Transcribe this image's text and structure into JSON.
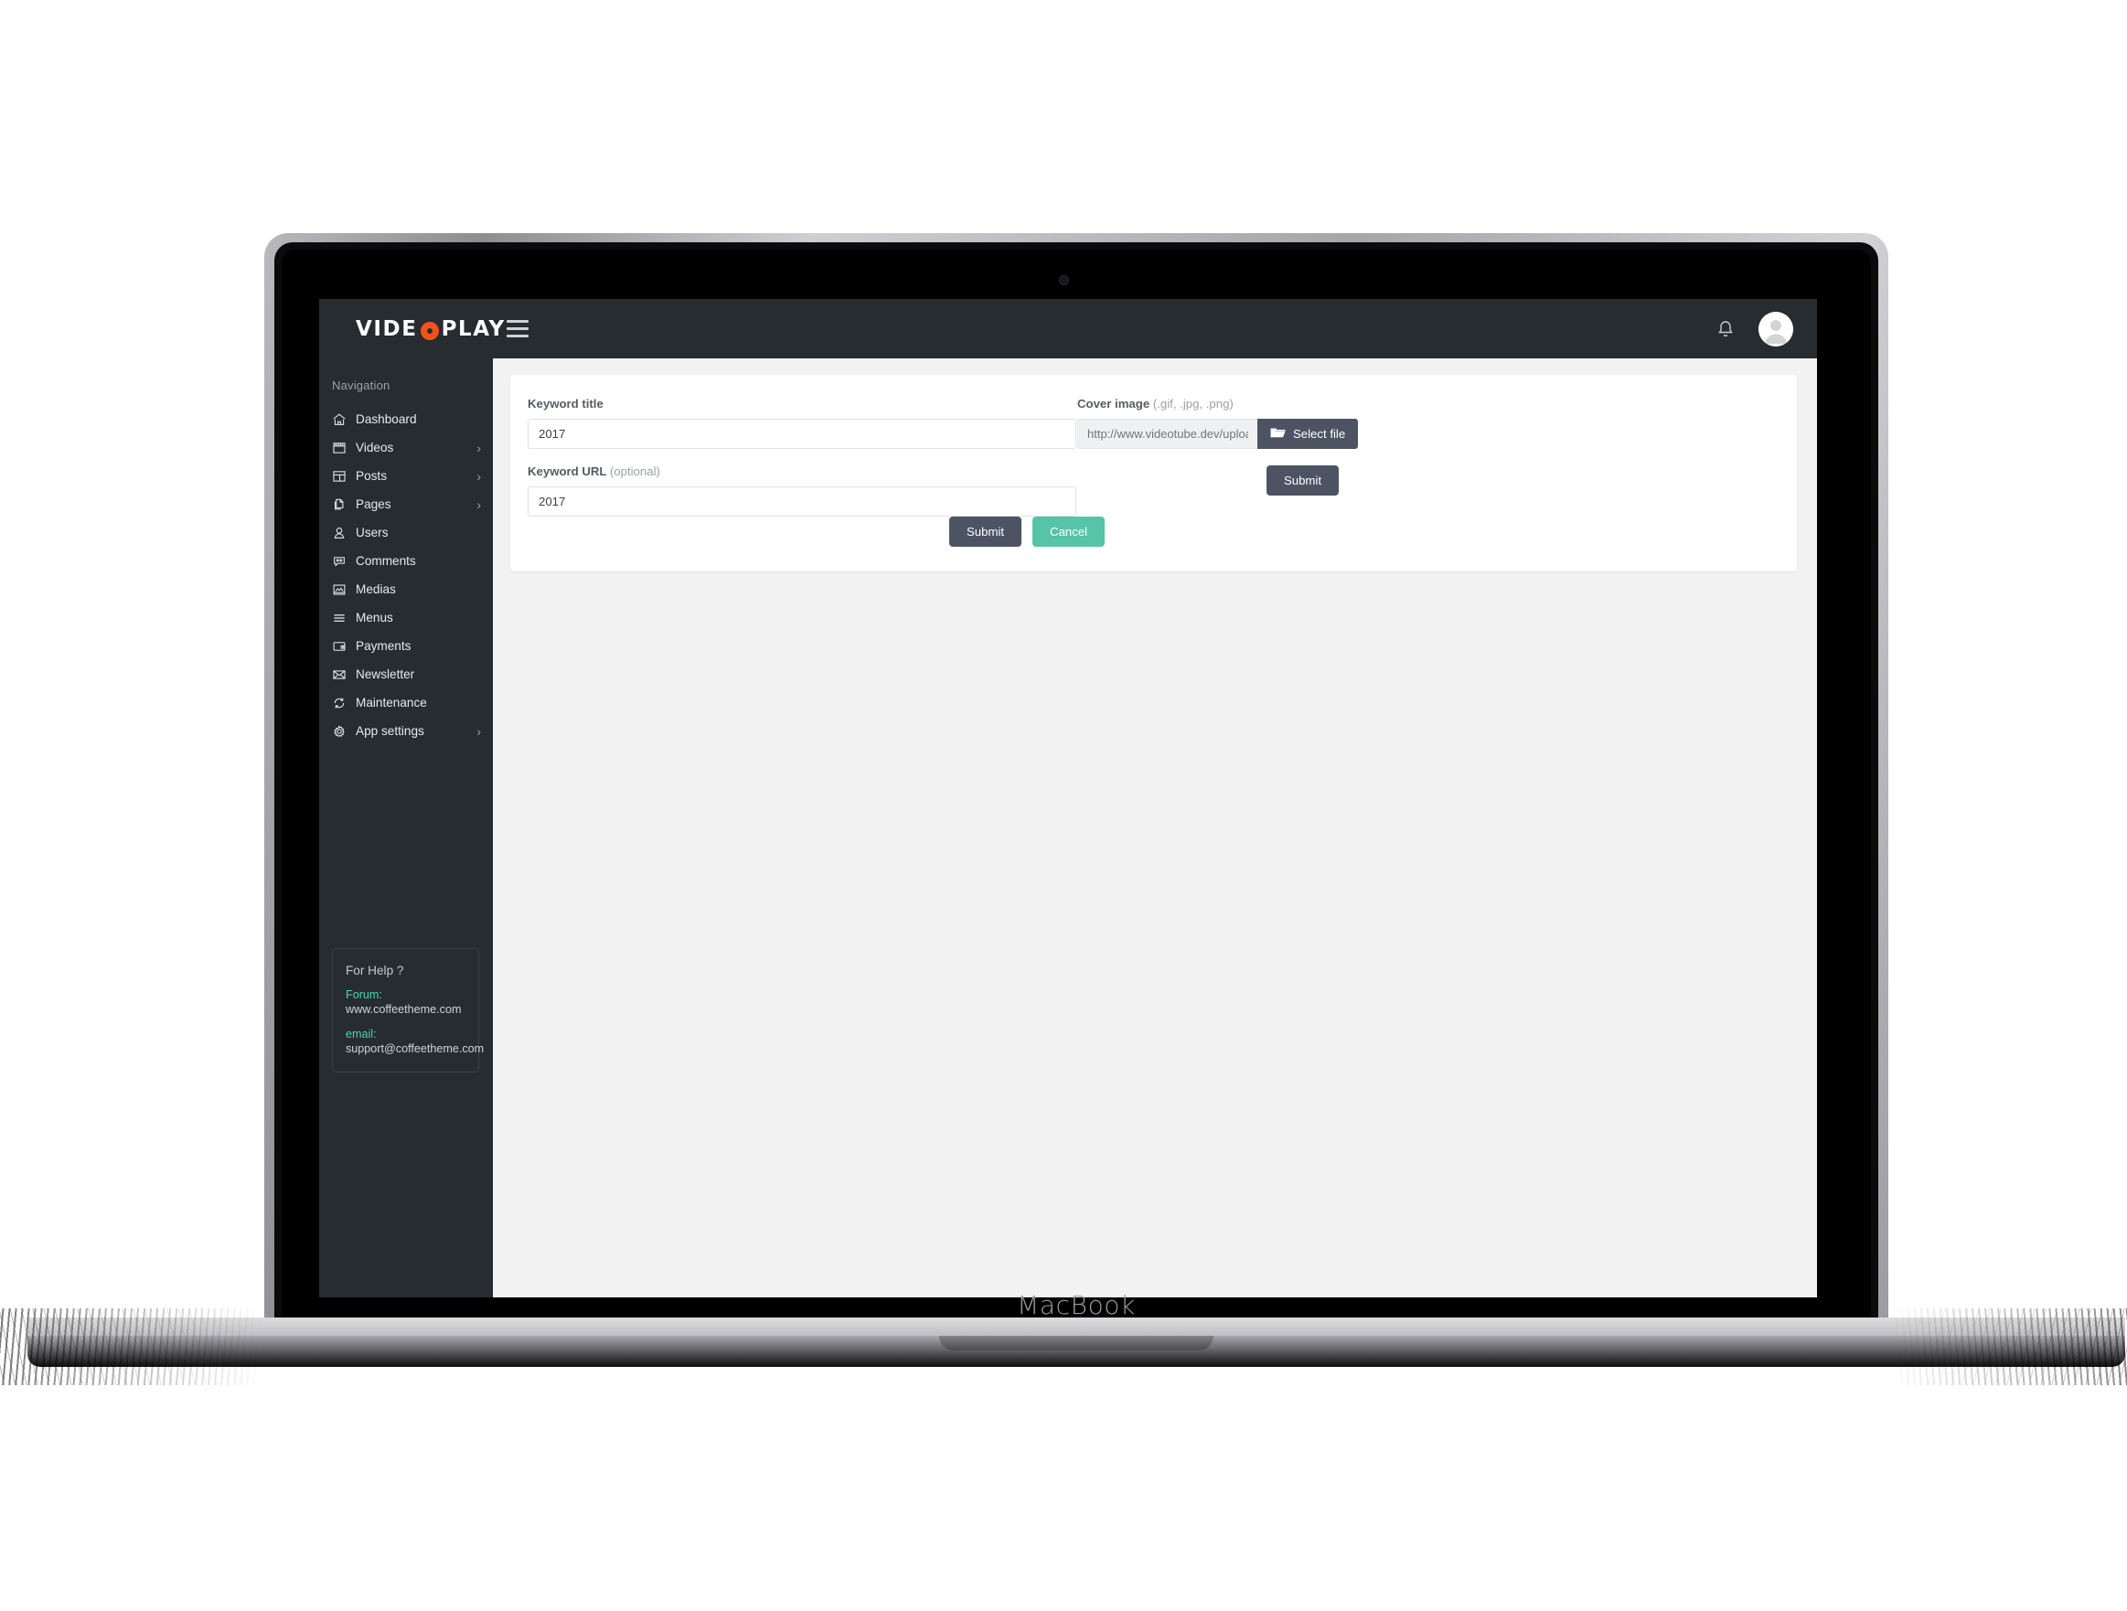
{
  "device": {
    "label": "MacBook"
  },
  "app": {
    "brand": {
      "text_before": "VIDE",
      "text_after": "PLAY",
      "accent_color": "#f4511e"
    },
    "header": {
      "menu_toggle": "hamburger-menu",
      "notifications": "bell-icon",
      "avatar": "user-avatar"
    },
    "sidebar": {
      "heading": "Navigation",
      "items": [
        {
          "label": "Dashboard",
          "icon": "home-icon",
          "has_submenu": false
        },
        {
          "label": "Videos",
          "icon": "film-icon",
          "has_submenu": true
        },
        {
          "label": "Posts",
          "icon": "layout-icon",
          "has_submenu": true
        },
        {
          "label": "Pages",
          "icon": "pages-icon",
          "has_submenu": true
        },
        {
          "label": "Users",
          "icon": "user-icon",
          "has_submenu": false
        },
        {
          "label": "Comments",
          "icon": "comment-icon",
          "has_submenu": false
        },
        {
          "label": "Medias",
          "icon": "image-icon",
          "has_submenu": false
        },
        {
          "label": "Menus",
          "icon": "list-icon",
          "has_submenu": false
        },
        {
          "label": "Payments",
          "icon": "wallet-icon",
          "has_submenu": false
        },
        {
          "label": "Newsletter",
          "icon": "envelope-icon",
          "has_submenu": false
        },
        {
          "label": "Maintenance",
          "icon": "refresh-icon",
          "has_submenu": false
        },
        {
          "label": "App settings",
          "icon": "gear-icon",
          "has_submenu": true
        }
      ],
      "help": {
        "title": "For Help ?",
        "forum_label": "Forum:",
        "forum_value": "www.coffeetheme.com",
        "email_label": "email:",
        "email_value": "support@coffeetheme.com",
        "accent_color": "#4fd3ae"
      }
    },
    "form": {
      "keyword_title": {
        "label": "Keyword title",
        "value": "2017"
      },
      "keyword_url": {
        "label": "Keyword URL",
        "optional_note": "(optional)",
        "value": "2017"
      },
      "submit_label": "Submit",
      "cancel_label": "Cancel",
      "cover_image": {
        "label": "Cover image",
        "formats_note": "(.gif, .jpg, .png)",
        "placeholder": "http://www.videotube.dev/uploads/i",
        "value": "",
        "select_file_label": "Select file",
        "select_file_icon": "folder-icon",
        "submit_label": "Submit"
      }
    },
    "colors": {
      "sidebar_bg": "#272c30",
      "button_dark": "#4c5464",
      "button_teal": "#56c4a7",
      "content_bg": "#f2f2f3"
    }
  }
}
